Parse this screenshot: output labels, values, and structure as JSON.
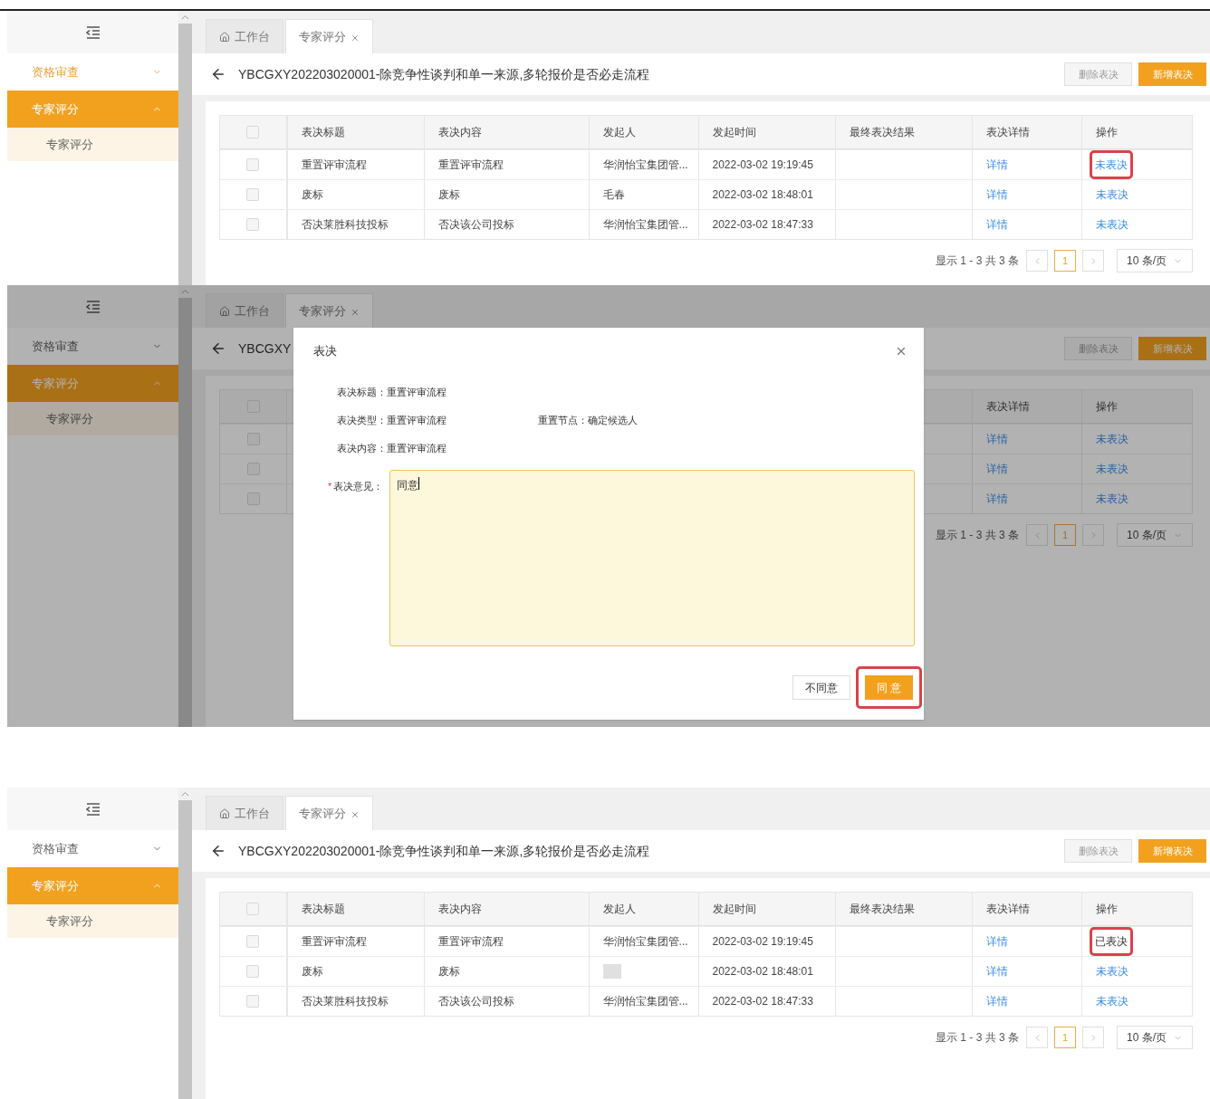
{
  "panels": [
    {
      "sidebar": {
        "items": [
          {
            "label": "资格审查",
            "expanded": false,
            "selected": false,
            "highlighted": true
          },
          {
            "label": "专家评分",
            "expanded": true,
            "selected": true,
            "highlighted": false,
            "children": [
              {
                "label": "专家评分",
                "selected": false
              }
            ]
          }
        ]
      },
      "tabs": [
        {
          "label": "工作台",
          "kind": "home",
          "selected": false
        },
        {
          "label": "专家评分",
          "kind": "closable",
          "selected": true
        }
      ],
      "header": {
        "title": "YBCGXY202203020001-除竞争性谈判和单一来源,多轮报价是否必走流程",
        "buttons": [
          {
            "label": "删除表决",
            "disabled": true
          },
          {
            "label": "新增表决",
            "disabled": false
          }
        ]
      },
      "table": {
        "header_checked": false,
        "columns": [
          "表决标题",
          "表决内容",
          "发起人",
          "发起时间",
          "最终表决结果",
          "表决详情",
          "操作"
        ],
        "rows": [
          {
            "checked": false,
            "title": "重置评审流程",
            "content": "重置评审流程",
            "initiator": "华润怡宝集团管...",
            "time": "2022-03-02 19:19:45",
            "detail": "详情",
            "action": {
              "text": "未表决",
              "done": false,
              "annotated": true
            }
          },
          {
            "checked": false,
            "title": "废标",
            "content": "废标",
            "initiator": "毛春",
            "time": "2022-03-02 18:48:01",
            "detail": "详情",
            "action": {
              "text": "未表决",
              "done": false,
              "annotated": false
            }
          },
          {
            "checked": false,
            "title": "否决莱胜科技投标",
            "content": "否决该公司投标",
            "initiator": "华润怡宝集团管...",
            "time": "2022-03-02 18:47:33",
            "detail": "详情",
            "action": {
              "text": "未表决",
              "done": false,
              "annotated": false
            }
          }
        ]
      },
      "pagination": {
        "info": "显示 1 - 3 共 3 条",
        "pages": [
          {
            "label": "1",
            "selected": true
          }
        ],
        "page_size": "10 条/页"
      }
    },
    {
      "sidebar": {
        "items": [
          {
            "label": "资格审查",
            "expanded": false,
            "selected": false,
            "highlighted": false
          },
          {
            "label": "专家评分",
            "expanded": true,
            "selected": true,
            "highlighted": false,
            "children": [
              {
                "label": "专家评分",
                "selected": false
              }
            ]
          }
        ]
      },
      "tabs": [
        {
          "label": "工作台",
          "kind": "home",
          "selected": false
        },
        {
          "label": "专家评分",
          "kind": "closable",
          "selected": true
        }
      ],
      "header": {
        "title": "YBCGXY",
        "buttons": [
          {
            "label": "删除表决",
            "disabled": true
          },
          {
            "label": "新增表决",
            "disabled": false
          }
        ]
      },
      "table": {
        "header_checked": false,
        "columns": [
          "表决详情",
          "操作"
        ],
        "rows": [
          {
            "checked": false,
            "detail": "详情",
            "action": {
              "text": "未表决",
              "done": false,
              "annotated": false
            }
          },
          {
            "checked": false,
            "detail": "详情",
            "action": {
              "text": "未表决",
              "done": false,
              "annotated": false
            }
          },
          {
            "checked": false,
            "detail": "详情",
            "action": {
              "text": "未表决",
              "done": false,
              "annotated": false
            }
          }
        ]
      },
      "pagination": {
        "info": "显示 1 - 3 共 3 条",
        "pages": [
          {
            "label": "1",
            "selected": true
          }
        ],
        "page_size": "10 条/页"
      },
      "dialog": {
        "title": "表决",
        "fields": [
          [
            {
              "label": "表决标题：",
              "value": "重置评审流程"
            }
          ],
          [
            {
              "label": "表决类型：",
              "value": "重置评审流程"
            },
            {
              "label": "重置节点：",
              "value": "确定候选人"
            }
          ],
          [
            {
              "label": "表决内容：",
              "value": "重置评审流程"
            }
          ]
        ],
        "opinion": {
          "required_mark": "*",
          "label": "表决意见：",
          "value": "同意",
          "focused": true
        },
        "buttons": [
          {
            "label": "不同意",
            "primary": false,
            "annotated": false
          },
          {
            "label": "同 意",
            "primary": true,
            "annotated": true
          }
        ]
      }
    },
    {
      "sidebar": {
        "items": [
          {
            "label": "资格审查",
            "expanded": false,
            "selected": false,
            "highlighted": false
          },
          {
            "label": "专家评分",
            "expanded": true,
            "selected": true,
            "highlighted": false,
            "children": [
              {
                "label": "专家评分",
                "selected": false
              }
            ]
          }
        ]
      },
      "tabs": [
        {
          "label": "工作台",
          "kind": "home",
          "selected": false
        },
        {
          "label": "专家评分",
          "kind": "closable",
          "selected": true
        }
      ],
      "header": {
        "title": "YBCGXY202203020001-除竞争性谈判和单一来源,多轮报价是否必走流程",
        "buttons": [
          {
            "label": "删除表决",
            "disabled": true
          },
          {
            "label": "新增表决",
            "disabled": false
          }
        ]
      },
      "table": {
        "header_checked": false,
        "columns": [
          "表决标题",
          "表决内容",
          "发起人",
          "发起时间",
          "最终表决结果",
          "表决详情",
          "操作"
        ],
        "rows": [
          {
            "checked": false,
            "title": "重置评审流程",
            "content": "重置评审流程",
            "initiator": "华润怡宝集团管...",
            "time": "2022-03-02 19:19:45",
            "detail": "详情",
            "action": {
              "text": "已表决",
              "done": true,
              "annotated": true
            }
          },
          {
            "checked": false,
            "title": "废标",
            "content": "废标",
            "initiator": {
              "kind": "blurred"
            },
            "time": "2022-03-02 18:48:01",
            "detail": "详情",
            "action": {
              "text": "未表决",
              "done": false,
              "annotated": false
            }
          },
          {
            "checked": false,
            "title": "否决莱胜科技投标",
            "content": "否决该公司投标",
            "initiator": "华润怡宝集团管...",
            "time": "2022-03-02 18:47:33",
            "detail": "详情",
            "action": {
              "text": "未表决",
              "done": false,
              "annotated": false
            }
          }
        ]
      },
      "pagination": {
        "info": "显示 1 - 3 共 3 条",
        "pages": [
          {
            "label": "1",
            "selected": true
          }
        ],
        "page_size": "10 条/页"
      }
    }
  ]
}
